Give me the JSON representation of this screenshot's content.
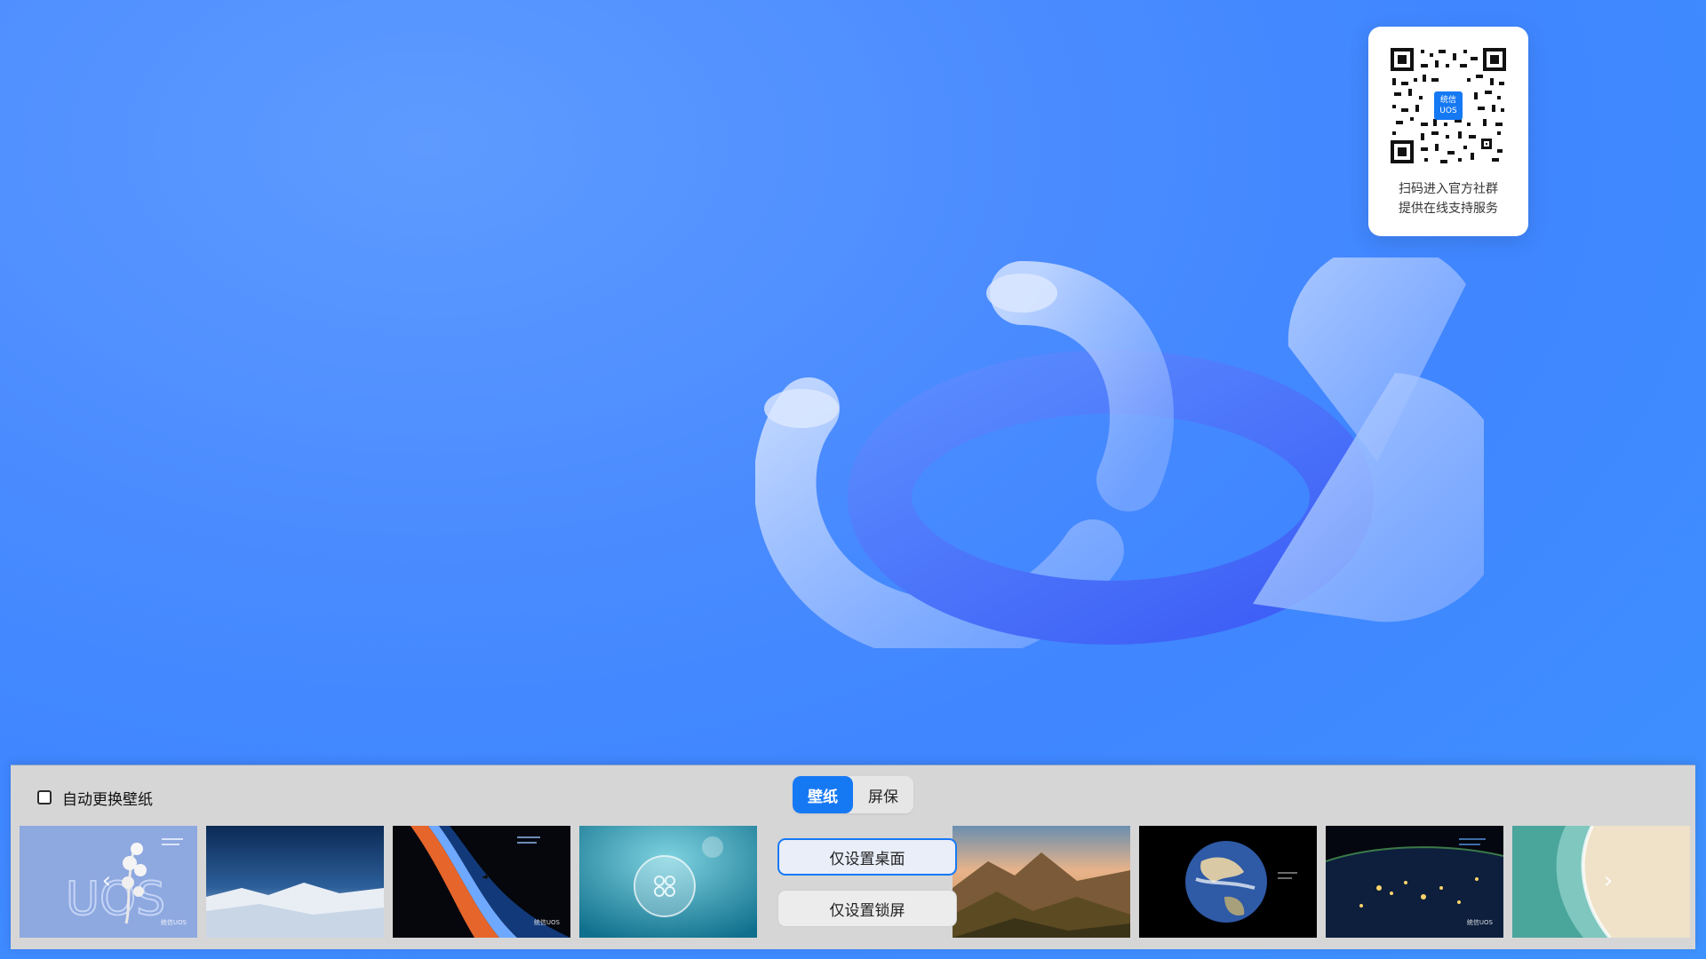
{
  "qr_card": {
    "line1": "扫码进入官方社群",
    "line2": "提供在线支持服务",
    "badge_top": "统信",
    "badge_bottom": "UOS"
  },
  "panel": {
    "auto_change_label": "自动更换壁纸",
    "auto_change_checked": false,
    "tabs": [
      {
        "label": "壁纸",
        "active": true
      },
      {
        "label": "屏保",
        "active": false
      }
    ],
    "actions": {
      "set_desktop": "仅设置桌面",
      "set_lockscreen": "仅设置锁屏"
    },
    "thumbnails": [
      {
        "name": "uos-orchid",
        "logo": "统信UOS"
      },
      {
        "name": "snow-mountains",
        "logo": ""
      },
      {
        "name": "space-horizon",
        "logo": "统信UOS"
      },
      {
        "name": "jellyfish",
        "logo": ""
      },
      {
        "name": "mountain-sunset",
        "logo": ""
      },
      {
        "name": "earth-globe",
        "logo": ""
      },
      {
        "name": "earth-night-lights",
        "logo": "统信UOS"
      },
      {
        "name": "beach-aerial",
        "logo": ""
      }
    ],
    "prev_arrow": "‹",
    "next_arrow": "›"
  },
  "colors": {
    "accent": "#1679f4",
    "desktop_bg": "#4a8bff",
    "panel_bg": "#d6d6d6"
  }
}
